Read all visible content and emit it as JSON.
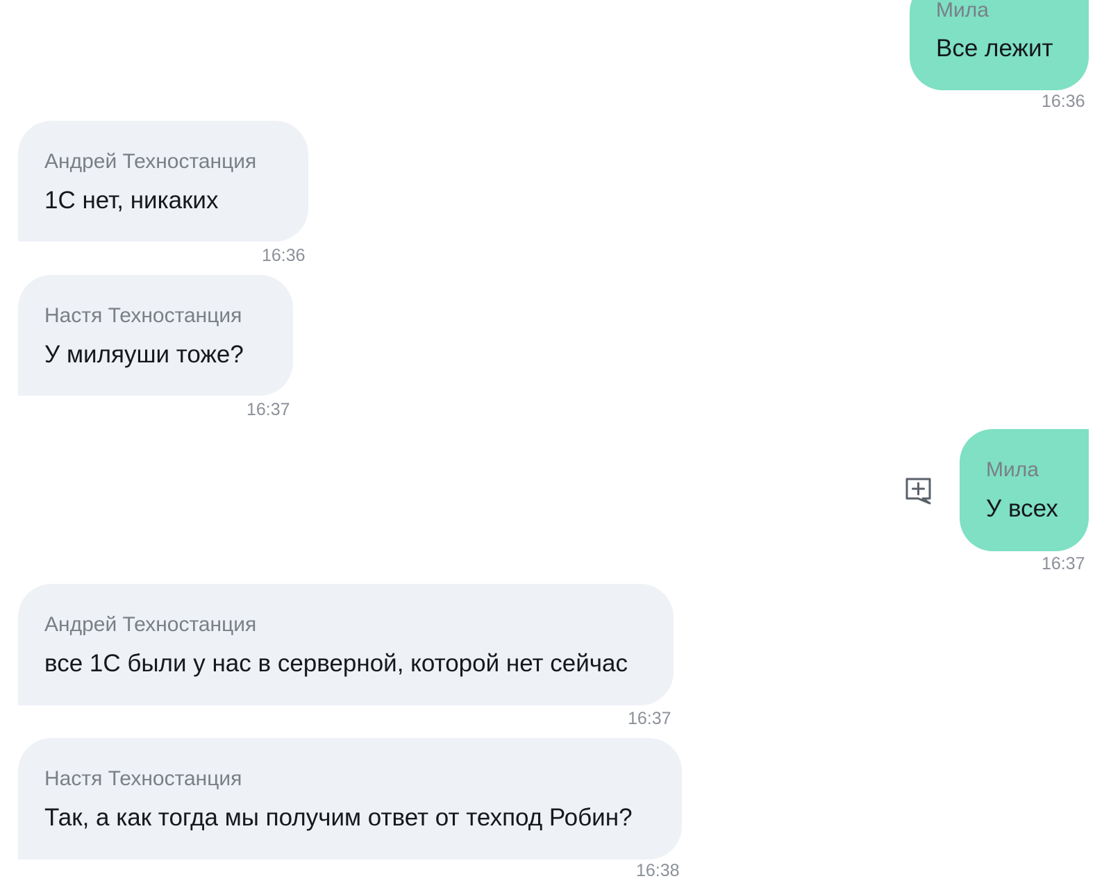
{
  "messages": [
    {
      "sender": "Мила",
      "text": "Все лежит",
      "time": "16:36",
      "outgoing": true
    },
    {
      "sender": "Андрей Техностанция",
      "text": "1С нет, никаких",
      "time": "16:36",
      "outgoing": false
    },
    {
      "sender": "Настя Техностанция",
      "text": "У миляуши тоже?",
      "time": "16:37",
      "outgoing": false
    },
    {
      "sender": "Мила",
      "text": "У всех",
      "time": "16:37",
      "outgoing": true
    },
    {
      "sender": "Андрей Техностанция",
      "text": "все 1С были у нас в серверной, которой нет сейчас",
      "time": "16:37",
      "outgoing": false
    },
    {
      "sender": "Настя Техностанция",
      "text": "Так, а как тогда мы получим ответ от техпод Робин?",
      "time": "16:38",
      "outgoing": false
    }
  ],
  "icons": {
    "message_action": "add-comment-icon"
  }
}
